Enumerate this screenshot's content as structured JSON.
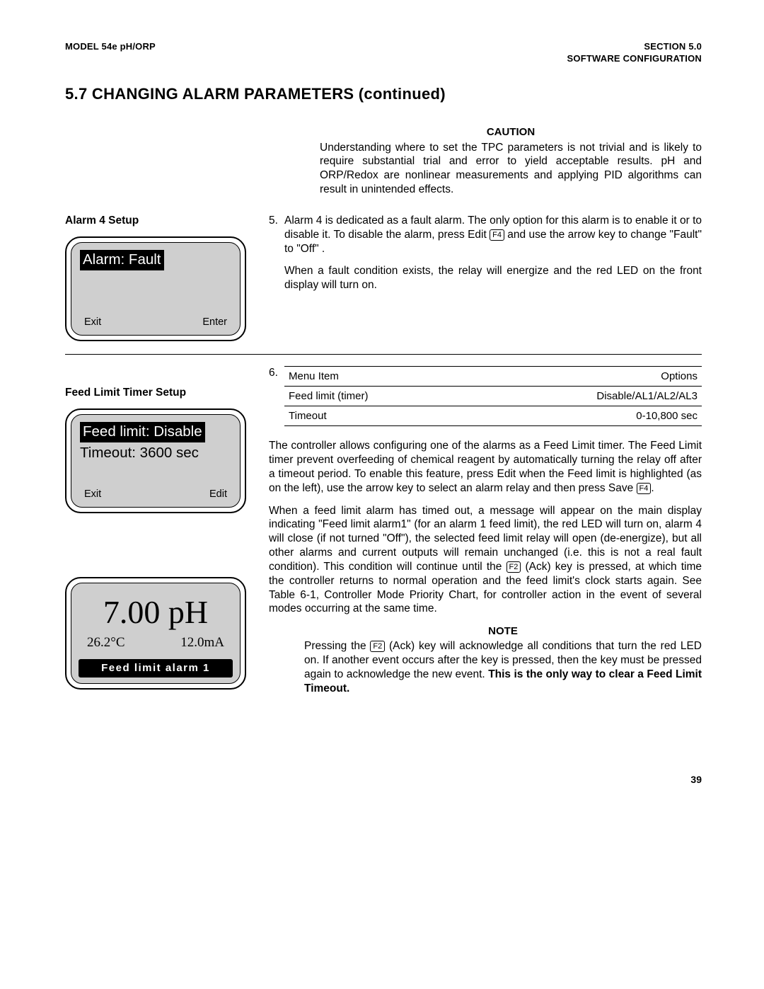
{
  "header": {
    "left": "MODEL 54e pH/ORP",
    "right1": "SECTION 5.0",
    "right2": "SOFTWARE CONFIGURATION"
  },
  "title": "5.7 CHANGING ALARM PARAMETERS (continued)",
  "caution": {
    "label": "CAUTION",
    "text": "Understanding where to set the TPC parameters is not trivial and is likely to require substantial trial and error to yield acceptable results.  pH and ORP/Redox are nonlinear measurements and applying PID algorithms can result in unintended effects."
  },
  "alarm4": {
    "heading": "Alarm 4 Setup",
    "lcd_selected": "Alarm: Fault",
    "lcd_exit": "Exit",
    "lcd_enter": "Enter",
    "num": "5.",
    "p1a": "Alarm 4 is dedicated as a fault alarm.  The only option for this alarm is to enable it or to disable it.  To disable the alarm, press Edit ",
    "key1": "F4",
    "p1b": " and use the arrow key to change \"Fault\" to \"Off\" .",
    "p2": "When a fault condition exists, the relay will energize and the red LED on the front display will turn on."
  },
  "feed": {
    "heading": "Feed Limit Timer Setup",
    "lcd_selected": "Feed limit: Disable",
    "lcd_line2": "Timeout: 3600 sec",
    "lcd_exit": "Exit",
    "lcd_edit": "Edit",
    "num": "6.",
    "table": {
      "h1": "Menu Item",
      "h2": "Options",
      "r1a": "Feed limit (timer)",
      "r1b": "Disable/AL1/AL2/AL3",
      "r2a": "Timeout",
      "r2b": "0-10,800 sec"
    },
    "p1a": "The controller allows configuring one of the alarms as a Feed Limit timer. The Feed Limit timer prevent overfeeding of chemical reagent by automatically turning the relay off after a timeout period. To enable this feature, press Edit when the Feed limit is highlighted (as on the left), use the arrow key to select an alarm relay and then press Save ",
    "key1": "F4",
    "p1b": ".",
    "p2a": "When a feed limit alarm has timed out, a message will appear on the main display indicating \"Feed limit alarm1\" (for an alarm 1 feed limit), the red LED will turn on, alarm 4 will close (if not turned \"Off\"), the selected feed limit relay will open (de-energize), but all other alarms and current outputs will remain unchanged (i.e. this is not a real fault condition). This condition will continue until the ",
    "key2": "F2",
    "p2b": " (Ack) key is pressed, at which time the controller returns to normal operation and the feed limit's clock starts again. See Table 6-1, Controller Mode Priority Chart, for controller action in the event of several modes occurring at the same time."
  },
  "display": {
    "ph": "7.00 pH",
    "temp": "26.2°C",
    "ma": "12.0mA",
    "bar": "Feed limit alarm 1"
  },
  "note": {
    "label": "NOTE",
    "t1": "Pressing the ",
    "key": "F2",
    "t2": " (Ack) key will acknowledge all conditions that turn the red LED on. If another event occurs after the key is pressed, then the key must be pressed again to acknowledge the new event. ",
    "bold": "This is the only way to clear a Feed Limit Timeout."
  },
  "page": "39"
}
